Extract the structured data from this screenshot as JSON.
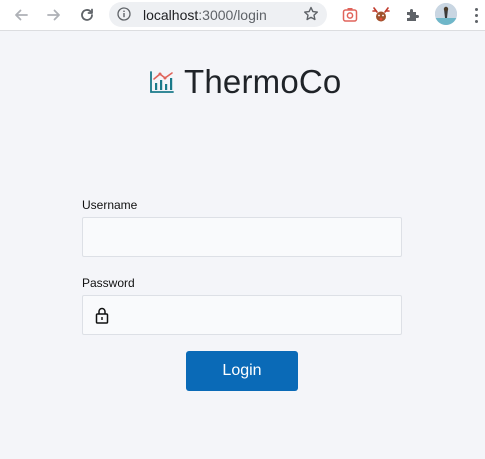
{
  "browser": {
    "url_host": "localhost",
    "url_path": ":3000/login"
  },
  "icons": {
    "back": "arrow-left-icon",
    "forward": "arrow-right-icon",
    "reload": "reload-icon",
    "site_info": "info-icon",
    "bookmark": "star-icon",
    "extensions": "puzzle-icon",
    "menu": "kebab-menu-icon",
    "brand": "chart-icon",
    "lock": "lock-icon"
  },
  "brand": {
    "name": "ThermoCo"
  },
  "form": {
    "username_label": "Username",
    "username_value": "",
    "password_label": "Password",
    "password_value": "",
    "submit_label": "Login"
  },
  "colors": {
    "page_bg": "#f4f5f9",
    "primary": "#0a6ab7",
    "brand_icon": "#1a7a8a"
  }
}
